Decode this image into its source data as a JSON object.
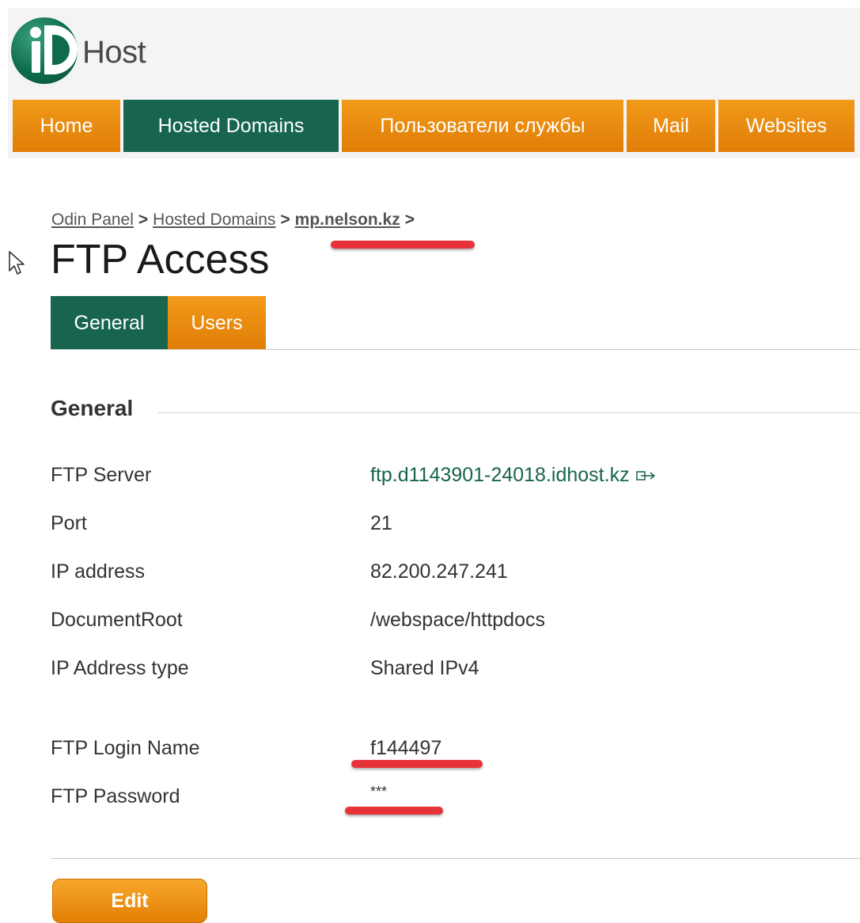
{
  "logo": {
    "text": "Host"
  },
  "nav": {
    "items": [
      {
        "label": "Home"
      },
      {
        "label": "Hosted Domains"
      },
      {
        "label": "Пользователи службы"
      },
      {
        "label": "Mail"
      },
      {
        "label": "Websites"
      }
    ],
    "active_index": 1
  },
  "breadcrumb": {
    "items": [
      "Odin Panel",
      "Hosted Domains",
      "mp.nelson.kz"
    ],
    "separator": ">"
  },
  "page": {
    "title": "FTP Access"
  },
  "tabs": {
    "items": [
      "General",
      "Users"
    ],
    "active_index": 0
  },
  "section": {
    "title": "General"
  },
  "fields": [
    {
      "label": "FTP Server",
      "value": "ftp.d1143901-24018.idhost.kz"
    },
    {
      "label": "Port",
      "value": "21"
    },
    {
      "label": "IP address",
      "value": "82.200.247.241"
    },
    {
      "label": "DocumentRoot",
      "value": "/webspace/httpdocs"
    },
    {
      "label": "IP Address type",
      "value": "Shared IPv4"
    },
    {
      "label": "FTP Login Name",
      "value": "f144497"
    },
    {
      "label": "FTP Password",
      "value": "***"
    }
  ],
  "actions": {
    "edit_label": "Edit"
  },
  "colors": {
    "accent_orange": "#e88a0f",
    "active_green": "#17654f",
    "annotation_red": "#e8323a"
  }
}
